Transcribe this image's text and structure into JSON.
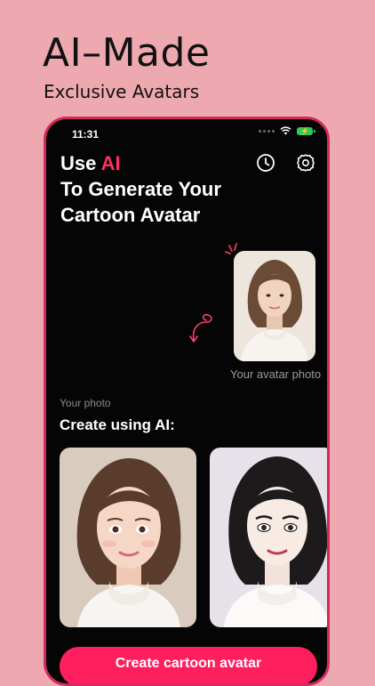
{
  "promo": {
    "title": "AI–Made",
    "subtitle": "Exclusive Avatars"
  },
  "status_bar": {
    "time": "11:31",
    "battery_icon": "battery-charging-icon",
    "wifi_icon": "wifi-icon"
  },
  "headline": {
    "prefix": "Use",
    "accent": "AI",
    "line2": "To Generate Your",
    "line3": "Cartoon Avatar"
  },
  "icons": {
    "history": "clock-icon",
    "settings": "gear-icon"
  },
  "avatar_caption": "Your avatar photo",
  "your_photo_label": "Your photo",
  "create_label": "Create using AI:",
  "cta_label": "Create cartoon avatar",
  "colors": {
    "background": "#eea9b0",
    "phone_border": "#d22a5f",
    "accent": "#ff2f63",
    "cta": "#ff1f5f"
  }
}
